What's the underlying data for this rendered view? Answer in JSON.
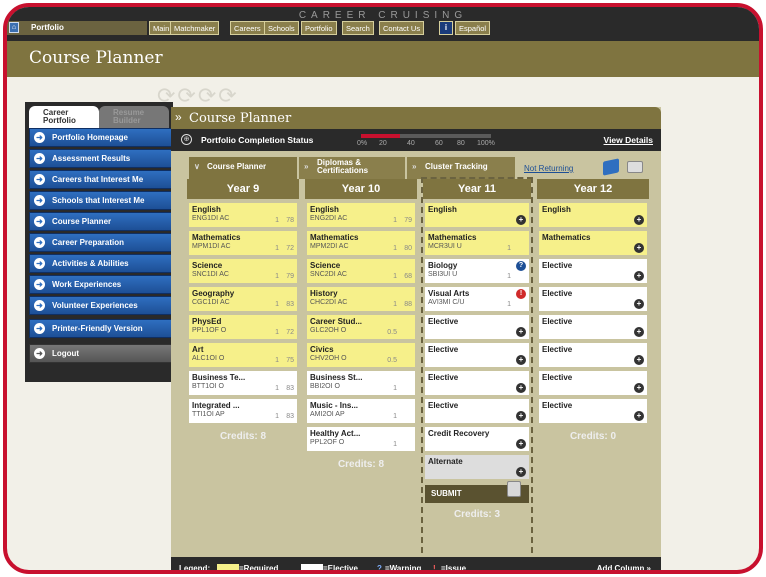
{
  "app": {
    "brand": "CAREER CRUISING",
    "home_label": "Portfolio"
  },
  "nav": [
    "Main",
    "Matchmaker",
    "Careers",
    "Schools",
    "Portfolio",
    "Search",
    "Contact Us"
  ],
  "nav_info": "i",
  "nav_lang": "Español",
  "page_title": "Course Planner",
  "sidebar": {
    "tabs": [
      "Career Portfolio",
      "Resume Builder"
    ],
    "items": [
      "Portfolio Homepage",
      "Assessment Results",
      "Careers that Interest Me",
      "Schools that Interest Me",
      "Course Planner",
      "Career Preparation",
      "Activities & Abilities",
      "Work Experiences",
      "Volunteer Experiences",
      "Printer-Friendly Version",
      "Logout"
    ]
  },
  "panel": {
    "title": "Course Planner",
    "status_label": "Portfolio Completion Status",
    "progress": 0.3,
    "ticks": [
      "0%",
      "20",
      "40",
      "60",
      "80",
      "100%"
    ],
    "view_details": "View Details",
    "tabs": [
      "Course Planner",
      "Diplomas & Certifications",
      "Cluster Tracking"
    ],
    "not_returning": "Not Returning"
  },
  "years": [
    {
      "label": "Year 9",
      "credits": "Credits: 8",
      "courses": [
        {
          "name": "English",
          "code": "ENG1DI AC",
          "credit": "1",
          "mark": "78",
          "type": "req"
        },
        {
          "name": "Mathematics",
          "code": "MPM1DI AC",
          "credit": "1",
          "mark": "72",
          "type": "req"
        },
        {
          "name": "Science",
          "code": "SNC1DI AC",
          "credit": "1",
          "mark": "79",
          "type": "req"
        },
        {
          "name": "Geography",
          "code": "CGC1DI AC",
          "credit": "1",
          "mark": "83",
          "type": "req"
        },
        {
          "name": "PhysEd",
          "code": "PPL1OF O",
          "credit": "1",
          "mark": "72",
          "type": "req"
        },
        {
          "name": "Art",
          "code": "ALC1OI O",
          "credit": "1",
          "mark": "75",
          "type": "req"
        },
        {
          "name": "Business Te...",
          "code": "BTT1OI O",
          "credit": "1",
          "mark": "83",
          "type": "elec"
        },
        {
          "name": "Integrated ...",
          "code": "TTI1OI AP",
          "credit": "1",
          "mark": "83",
          "type": "elec"
        }
      ]
    },
    {
      "label": "Year 10",
      "credits": "Credits: 8",
      "courses": [
        {
          "name": "English",
          "code": "ENG2DI AC",
          "credit": "1",
          "mark": "79",
          "type": "req"
        },
        {
          "name": "Mathematics",
          "code": "MPM2DI AC",
          "credit": "1",
          "mark": "80",
          "type": "req"
        },
        {
          "name": "Science",
          "code": "SNC2DI AC",
          "credit": "1",
          "mark": "68",
          "type": "req"
        },
        {
          "name": "History",
          "code": "CHC2DI AC",
          "credit": "1",
          "mark": "88",
          "type": "req"
        },
        {
          "name": "Career Stud...",
          "code": "GLC2OH O",
          "credit": "0.5",
          "mark": "",
          "type": "req"
        },
        {
          "name": "Civics",
          "code": "CHV2OH O",
          "credit": "0.5",
          "mark": "",
          "type": "req"
        },
        {
          "name": "Business St...",
          "code": "BBI2OI O",
          "credit": "1",
          "mark": "",
          "type": "elec"
        },
        {
          "name": "Music - Ins...",
          "code": "AMI2OI AP",
          "credit": "1",
          "mark": "",
          "type": "elec"
        },
        {
          "name": "Healthy Act...",
          "code": "PPL2OF O",
          "credit": "1",
          "mark": "",
          "type": "elec"
        }
      ]
    },
    {
      "label": "Year 11",
      "credits": "Credits: 3",
      "courses": [
        {
          "name": "English",
          "code": "",
          "credit": "",
          "mark": "",
          "type": "req",
          "plus": true
        },
        {
          "name": "Mathematics",
          "code": "MCR3UI U",
          "credit": "1",
          "mark": "",
          "type": "req"
        },
        {
          "name": "Biology",
          "code": "SBI3UI U",
          "credit": "1",
          "mark": "",
          "type": "elec",
          "flag": "warning"
        },
        {
          "name": "Visual Arts",
          "code": "AVI3MI C/U",
          "credit": "1",
          "mark": "",
          "type": "elec",
          "flag": "issue"
        },
        {
          "name": "Elective",
          "code": "",
          "credit": "",
          "mark": "",
          "type": "elec",
          "plus": true
        },
        {
          "name": "Elective",
          "code": "",
          "credit": "",
          "mark": "",
          "type": "elec",
          "plus": true
        },
        {
          "name": "Elective",
          "code": "",
          "credit": "",
          "mark": "",
          "type": "elec",
          "plus": true
        },
        {
          "name": "Elective",
          "code": "",
          "credit": "",
          "mark": "",
          "type": "elec",
          "plus": true
        },
        {
          "name": "Credit Recovery",
          "code": "",
          "credit": "",
          "mark": "",
          "type": "elec",
          "plus": true
        },
        {
          "name": "Alternate",
          "code": "",
          "credit": "",
          "mark": "",
          "type": "alt",
          "plus": true
        }
      ],
      "submit": "SUBMIT"
    },
    {
      "label": "Year 12",
      "credits": "Credits: 0",
      "courses": [
        {
          "name": "English",
          "code": "",
          "credit": "",
          "mark": "",
          "type": "req",
          "plus": true
        },
        {
          "name": "Mathematics",
          "code": "",
          "credit": "",
          "mark": "",
          "type": "req",
          "plus": true
        },
        {
          "name": "Elective",
          "code": "",
          "credit": "",
          "mark": "",
          "type": "elec",
          "plus": true
        },
        {
          "name": "Elective",
          "code": "",
          "credit": "",
          "mark": "",
          "type": "elec",
          "plus": true
        },
        {
          "name": "Elective",
          "code": "",
          "credit": "",
          "mark": "",
          "type": "elec",
          "plus": true
        },
        {
          "name": "Elective",
          "code": "",
          "credit": "",
          "mark": "",
          "type": "elec",
          "plus": true
        },
        {
          "name": "Elective",
          "code": "",
          "credit": "",
          "mark": "",
          "type": "elec",
          "plus": true
        },
        {
          "name": "Elective",
          "code": "",
          "credit": "",
          "mark": "",
          "type": "elec",
          "plus": true
        }
      ]
    }
  ],
  "legend": {
    "label": "Legend:",
    "required": "=Required",
    "elective": "=Elective",
    "warning": "=Warning",
    "issue": "=Issue",
    "add_column": "Add Column »"
  },
  "colors": {
    "required": "#f6f08a",
    "elective": "#ffffff",
    "accent": "#7f7440",
    "frame": "#c8102e"
  }
}
